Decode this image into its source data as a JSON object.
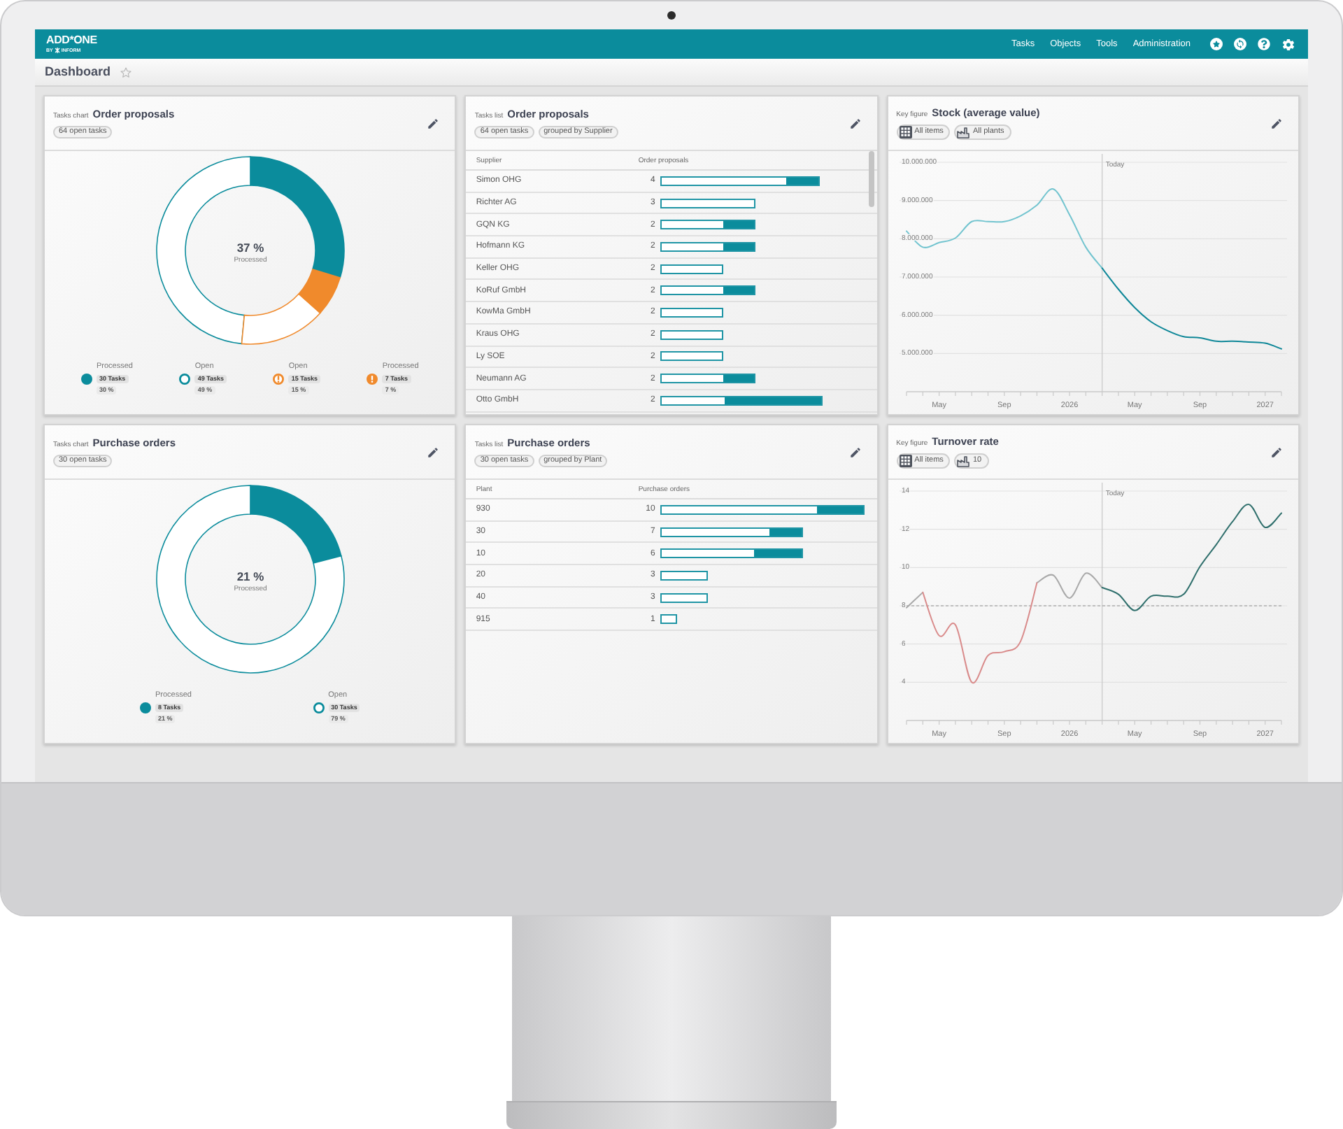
{
  "header": {
    "logo": {
      "name": "ADD*ONE",
      "tagline": "BY",
      "brand": "INFORM"
    },
    "nav": [
      "Tasks",
      "Objects",
      "Tools",
      "Administration"
    ]
  },
  "page": {
    "title": "Dashboard",
    "favorite": false
  },
  "cards": [
    {
      "kind": "donut",
      "label": "Tasks chart",
      "title": "Order proposals",
      "chips": [
        {
          "kind": "plain",
          "text": "64 open tasks"
        }
      ],
      "center": {
        "value": "37 %",
        "label": "Processed"
      },
      "chart_data": {
        "type": "donut",
        "values": [
          30,
          49,
          15,
          7
        ],
        "colors": [
          "#0b8c9c",
          "#0b8c9c",
          "#f08a2c",
          "#f08a2c"
        ]
      },
      "legend": [
        {
          "label": "Processed",
          "tasks": "30 Tasks",
          "percent": "30 %",
          "kind": "filled",
          "color": "#0b8c9c"
        },
        {
          "label": "Open",
          "tasks": "49 Tasks",
          "percent": "49 %",
          "kind": "outline",
          "color": "#0b8c9c"
        },
        {
          "label": "Open",
          "tasks": "15 Tasks",
          "percent": "15 %",
          "kind": "outline-alert",
          "color": "#f08a2c"
        },
        {
          "label": "Processed",
          "tasks": "7 Tasks",
          "percent": "7 %",
          "kind": "filled-alert",
          "color": "#f08a2c"
        }
      ]
    },
    {
      "kind": "table",
      "label": "Tasks list",
      "title": "Order proposals",
      "chips": [
        {
          "kind": "plain",
          "text": "64 open tasks"
        },
        {
          "kind": "plain",
          "text": "grouped by Supplier"
        }
      ],
      "columns": [
        "Supplier",
        "Order proposals"
      ],
      "rows": [
        {
          "name": "Simon OHG",
          "count": "4",
          "processed": {
            "level": 0.21
          }
        },
        {
          "name": "Richter AG",
          "count": "3"
        },
        {
          "name": "GQN KG",
          "count": "2",
          "processed": {
            "level": 0.34
          }
        },
        {
          "name": "Hofmann KG",
          "count": "2",
          "processed": {
            "level": 0.34
          }
        },
        {
          "name": "Keller OHG",
          "count": "2"
        },
        {
          "name": "KoRuf GmbH",
          "count": "2",
          "processed": {
            "level": 0.34
          }
        },
        {
          "name": "KowMa GmbH",
          "count": "2"
        },
        {
          "name": "Kraus OHG",
          "count": "2"
        },
        {
          "name": "Ly SOE",
          "count": "2"
        },
        {
          "name": "Neumann AG",
          "count": "2",
          "processed": {
            "level": 0.34
          }
        },
        {
          "name": "Otto GmbH",
          "count": "2",
          "processed": {
            "level": 0.61
          }
        }
      ]
    },
    {
      "kind": "line",
      "label": "Key figure",
      "title": "Stock (average value)",
      "chips": [
        {
          "kind": "items",
          "text": "All items"
        },
        {
          "kind": "plants",
          "text": "All plants"
        }
      ],
      "chart_data": {
        "type": "line",
        "grid": true,
        "x": [
          "2025-03",
          "2025-04",
          "2025-05",
          "2025-06",
          "2025-07",
          "2025-08",
          "2025-09",
          "2025-10",
          "2025-11",
          "2025-12",
          "2026-01",
          "2026-02",
          "2026-03",
          "2026-04",
          "2026-05",
          "2026-06",
          "2026-07",
          "2026-08",
          "2026-09",
          "2026-10",
          "2026-11",
          "2026-12",
          "2027-01",
          "2027-02"
        ],
        "xlim": [
          "2025-03",
          "2027-02"
        ],
        "xticks": [
          {
            "value": "2025-05",
            "label": "May"
          },
          {
            "value": "2025-09",
            "label": "Sep"
          },
          {
            "value": "2026-01",
            "label": "2026"
          },
          {
            "value": "2026-05",
            "label": "May"
          },
          {
            "value": "2026-09",
            "label": "Sep"
          },
          {
            "value": "2027-01",
            "label": "2027"
          }
        ],
        "ylim": [
          4000000,
          10000000
        ],
        "yticks": [
          {
            "value": 5000000,
            "label": "5.000.000"
          },
          {
            "value": 6000000,
            "label": "6.000.000"
          },
          {
            "value": 7000000,
            "label": "7.000.000"
          },
          {
            "value": 8000000,
            "label": "8.000.000"
          },
          {
            "value": 9000000,
            "label": "9.000.000"
          },
          {
            "value": 10000000,
            "label": "10.000.000"
          }
        ],
        "series": [
          {
            "color": "#72c4cf",
            "values": [
              8200000,
              7780000,
              7900000,
              8020000,
              8450000,
              8450000,
              8450000,
              8600000,
              8880000,
              9300000,
              8630000,
              7780000,
              7230000,
              null,
              null,
              null,
              null,
              null,
              null,
              null,
              null,
              null,
              null,
              null
            ]
          },
          {
            "color": "#0e8798",
            "values": [
              null,
              null,
              null,
              null,
              null,
              null,
              null,
              null,
              null,
              null,
              null,
              null,
              7230000,
              6680000,
              6200000,
              5830000,
              5600000,
              5440000,
              5410000,
              5320000,
              5320000,
              5300000,
              5270000,
              5120000
            ]
          }
        ],
        "ref_lines": [
          {
            "axis": "x",
            "value": "2026-03",
            "label": "Today"
          }
        ]
      }
    },
    {
      "kind": "donut",
      "label": "Tasks chart",
      "title": "Purchase orders",
      "chips": [
        {
          "kind": "plain",
          "text": "30 open tasks"
        }
      ],
      "center": {
        "value": "21 %",
        "label": "Processed"
      },
      "chart_data": {
        "type": "donut",
        "values": [
          21,
          79
        ],
        "colors": [
          "#0b8c9c",
          "#0b8c9c"
        ]
      },
      "legend": [
        {
          "label": "Processed",
          "tasks": "8 Tasks",
          "percent": "21 %",
          "kind": "filled",
          "color": "#0b8c9c"
        },
        {
          "label": "Open",
          "tasks": "30 Tasks",
          "percent": "79 %",
          "kind": "outline",
          "color": "#0b8c9c"
        }
      ]
    },
    {
      "kind": "table",
      "label": "Tasks list",
      "title": "Purchase orders",
      "chips": [
        {
          "kind": "plain",
          "text": "30 open tasks"
        },
        {
          "kind": "plain",
          "text": "grouped by Plant"
        }
      ],
      "columns": [
        "Plant",
        "Purchase orders"
      ],
      "rows": [
        {
          "name": "930",
          "count": "10",
          "processed": {
            "level": 0.23
          }
        },
        {
          "name": "30",
          "count": "7",
          "processed": {
            "level": 0.23
          }
        },
        {
          "name": "10",
          "count": "6",
          "processed": {
            "level": 0.34
          }
        },
        {
          "name": "20",
          "count": "3"
        },
        {
          "name": "40",
          "count": "3"
        },
        {
          "name": "915",
          "count": "1"
        }
      ]
    },
    {
      "kind": "line",
      "label": "Key figure",
      "title": "Turnover rate",
      "chips": [
        {
          "kind": "items",
          "text": "All items"
        },
        {
          "kind": "plants",
          "text": "10"
        }
      ],
      "chart_data": {
        "type": "line",
        "grid": true,
        "x": [
          "2025-03",
          "2025-04",
          "2025-05",
          "2025-06",
          "2025-07",
          "2025-08",
          "2025-09",
          "2025-10",
          "2025-11",
          "2025-12",
          "2026-01",
          "2026-02",
          "2026-03",
          "2026-04",
          "2026-05",
          "2026-06",
          "2026-07",
          "2026-08",
          "2026-09",
          "2026-10",
          "2026-11",
          "2026-12",
          "2027-01",
          "2027-02"
        ],
        "xlim": [
          "2025-03",
          "2027-02"
        ],
        "xticks": [
          {
            "value": "2025-05",
            "label": "May"
          },
          {
            "value": "2025-09",
            "label": "Sep"
          },
          {
            "value": "2026-01",
            "label": "2026"
          },
          {
            "value": "2026-05",
            "label": "May"
          },
          {
            "value": "2026-09",
            "label": "Sep"
          },
          {
            "value": "2027-01",
            "label": "2027"
          }
        ],
        "ylim": [
          2,
          14
        ],
        "yticks": [
          4,
          6,
          8,
          10,
          12,
          14
        ],
        "series": [
          {
            "color": "#a9a9a9",
            "values": [
              7.9,
              8.7,
              null,
              null,
              null,
              null,
              null,
              null,
              9.2,
              9.6,
              8.4,
              9.7,
              8.95,
              null,
              null,
              null,
              null,
              null,
              null,
              null,
              null,
              null,
              null,
              null
            ]
          },
          {
            "color": "#d98b8b",
            "values": [
              null,
              8.7,
              6.44,
              7.0,
              4.0,
              5.4,
              5.6,
              6.15,
              9.2,
              null,
              null,
              null,
              null,
              null,
              null,
              null,
              null,
              null,
              null,
              null,
              null,
              null,
              null,
              null
            ]
          },
          {
            "color": "#2f6f6c",
            "values": [
              null,
              null,
              null,
              null,
              null,
              null,
              null,
              null,
              null,
              null,
              null,
              null,
              8.95,
              8.6,
              7.75,
              8.5,
              8.5,
              8.6,
              10.05,
              11.2,
              12.4,
              13.3,
              12.1,
              12.85
            ]
          }
        ],
        "ref_lines": [
          {
            "axis": "x",
            "value": "2026-03",
            "label": "Today"
          },
          {
            "axis": "y",
            "value": 8,
            "line_style": "dashed"
          }
        ]
      }
    }
  ]
}
